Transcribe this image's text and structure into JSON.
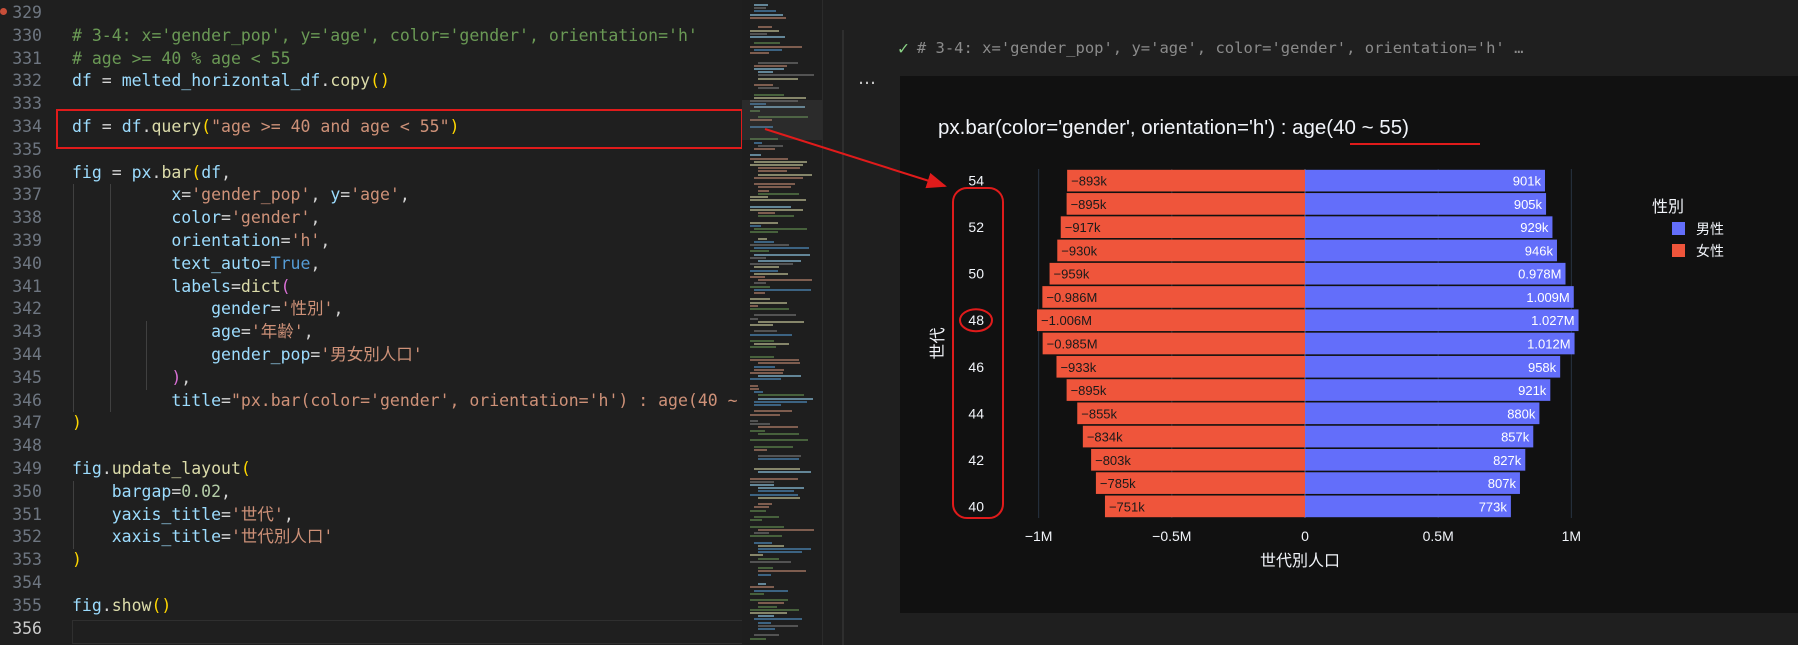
{
  "editor": {
    "lines": [
      {
        "no": "329",
        "tokens": []
      },
      {
        "no": "330",
        "tokens": [
          {
            "t": "# 3-4: x='gender_pop', y='age', color='gender', orientation='h'",
            "c": "com"
          }
        ]
      },
      {
        "no": "331",
        "tokens": [
          {
            "t": "# age >= 40 % age < 55",
            "c": "com"
          }
        ]
      },
      {
        "no": "332",
        "tokens": [
          {
            "t": "df",
            "c": "var"
          },
          {
            "t": " = ",
            "c": "op"
          },
          {
            "t": "melted_horizontal_df",
            "c": "var"
          },
          {
            "t": ".",
            "c": "op"
          },
          {
            "t": "copy",
            "c": "fn"
          },
          {
            "t": "()",
            "c": "pun"
          }
        ]
      },
      {
        "no": "333",
        "tokens": []
      },
      {
        "no": "334",
        "tokens": [
          {
            "t": "df",
            "c": "var"
          },
          {
            "t": " = ",
            "c": "op"
          },
          {
            "t": "df",
            "c": "var"
          },
          {
            "t": ".",
            "c": "op"
          },
          {
            "t": "query",
            "c": "fn"
          },
          {
            "t": "(",
            "c": "pun"
          },
          {
            "t": "\"age >= 40 and age < 55\"",
            "c": "str"
          },
          {
            "t": ")",
            "c": "pun"
          }
        ]
      },
      {
        "no": "335",
        "tokens": []
      },
      {
        "no": "336",
        "tokens": [
          {
            "t": "fig",
            "c": "var"
          },
          {
            "t": " = ",
            "c": "op"
          },
          {
            "t": "px",
            "c": "var"
          },
          {
            "t": ".",
            "c": "op"
          },
          {
            "t": "bar",
            "c": "fn"
          },
          {
            "t": "(",
            "c": "pun"
          },
          {
            "t": "df",
            "c": "var"
          },
          {
            "t": ",",
            "c": "op"
          }
        ]
      },
      {
        "no": "337",
        "tokens": [
          {
            "t": "          ",
            "c": "op"
          },
          {
            "t": "x",
            "c": "var"
          },
          {
            "t": "=",
            "c": "op"
          },
          {
            "t": "'gender_pop'",
            "c": "str"
          },
          {
            "t": ", ",
            "c": "op"
          },
          {
            "t": "y",
            "c": "var"
          },
          {
            "t": "=",
            "c": "op"
          },
          {
            "t": "'age'",
            "c": "str"
          },
          {
            "t": ",",
            "c": "op"
          }
        ]
      },
      {
        "no": "338",
        "tokens": [
          {
            "t": "          ",
            "c": "op"
          },
          {
            "t": "color",
            "c": "var"
          },
          {
            "t": "=",
            "c": "op"
          },
          {
            "t": "'gender'",
            "c": "str"
          },
          {
            "t": ",",
            "c": "op"
          }
        ]
      },
      {
        "no": "339",
        "tokens": [
          {
            "t": "          ",
            "c": "op"
          },
          {
            "t": "orientation",
            "c": "var"
          },
          {
            "t": "=",
            "c": "op"
          },
          {
            "t": "'h'",
            "c": "str"
          },
          {
            "t": ",",
            "c": "op"
          }
        ]
      },
      {
        "no": "340",
        "tokens": [
          {
            "t": "          ",
            "c": "op"
          },
          {
            "t": "text_auto",
            "c": "var"
          },
          {
            "t": "=",
            "c": "op"
          },
          {
            "t": "True",
            "c": "kw"
          },
          {
            "t": ",",
            "c": "op"
          }
        ]
      },
      {
        "no": "341",
        "tokens": [
          {
            "t": "          ",
            "c": "op"
          },
          {
            "t": "labels",
            "c": "var"
          },
          {
            "t": "=",
            "c": "op"
          },
          {
            "t": "dict",
            "c": "fn"
          },
          {
            "t": "(",
            "c": "pun2"
          }
        ]
      },
      {
        "no": "342",
        "tokens": [
          {
            "t": "              ",
            "c": "op"
          },
          {
            "t": "gender",
            "c": "var"
          },
          {
            "t": "=",
            "c": "op"
          },
          {
            "t": "'性別'",
            "c": "str"
          },
          {
            "t": ",",
            "c": "op"
          }
        ]
      },
      {
        "no": "343",
        "tokens": [
          {
            "t": "              ",
            "c": "op"
          },
          {
            "t": "age",
            "c": "var"
          },
          {
            "t": "=",
            "c": "op"
          },
          {
            "t": "'年齢'",
            "c": "str"
          },
          {
            "t": ",",
            "c": "op"
          }
        ]
      },
      {
        "no": "344",
        "tokens": [
          {
            "t": "              ",
            "c": "op"
          },
          {
            "t": "gender_pop",
            "c": "var"
          },
          {
            "t": "=",
            "c": "op"
          },
          {
            "t": "'男女別人口'",
            "c": "str"
          }
        ]
      },
      {
        "no": "345",
        "tokens": [
          {
            "t": "          ",
            "c": "op"
          },
          {
            "t": ")",
            "c": "pun2"
          },
          {
            "t": ",",
            "c": "op"
          }
        ]
      },
      {
        "no": "346",
        "tokens": [
          {
            "t": "          ",
            "c": "op"
          },
          {
            "t": "title",
            "c": "var"
          },
          {
            "t": "=",
            "c": "op"
          },
          {
            "t": "\"px.bar(color='gender', orientation='h') : age(40 ~ 55)\"",
            "c": "str"
          }
        ]
      },
      {
        "no": "347",
        "tokens": [
          {
            "t": ")",
            "c": "pun"
          }
        ]
      },
      {
        "no": "348",
        "tokens": []
      },
      {
        "no": "349",
        "tokens": [
          {
            "t": "fig",
            "c": "var"
          },
          {
            "t": ".",
            "c": "op"
          },
          {
            "t": "update_layout",
            "c": "fn"
          },
          {
            "t": "(",
            "c": "pun"
          }
        ]
      },
      {
        "no": "350",
        "tokens": [
          {
            "t": "    ",
            "c": "op"
          },
          {
            "t": "bargap",
            "c": "var"
          },
          {
            "t": "=",
            "c": "op"
          },
          {
            "t": "0.02",
            "c": "num"
          },
          {
            "t": ",",
            "c": "op"
          }
        ]
      },
      {
        "no": "351",
        "tokens": [
          {
            "t": "    ",
            "c": "op"
          },
          {
            "t": "yaxis_title",
            "c": "var"
          },
          {
            "t": "=",
            "c": "op"
          },
          {
            "t": "'世代'",
            "c": "str"
          },
          {
            "t": ",",
            "c": "op"
          }
        ]
      },
      {
        "no": "352",
        "tokens": [
          {
            "t": "    ",
            "c": "op"
          },
          {
            "t": "xaxis_title",
            "c": "var"
          },
          {
            "t": "=",
            "c": "op"
          },
          {
            "t": "'世代別人口'",
            "c": "str"
          }
        ]
      },
      {
        "no": "353",
        "tokens": [
          {
            "t": ")",
            "c": "pun"
          }
        ]
      },
      {
        "no": "354",
        "tokens": []
      },
      {
        "no": "355",
        "tokens": [
          {
            "t": "fig",
            "c": "var"
          },
          {
            "t": ".",
            "c": "op"
          },
          {
            "t": "show",
            "c": "fn"
          },
          {
            "t": "()",
            "c": "pun"
          }
        ]
      },
      {
        "no": "356",
        "tokens": []
      }
    ],
    "active_line": "356"
  },
  "output": {
    "cell_header": "# 3-4: x='gender_pop', y='age', color='gender', orientation='h' …",
    "more_label": "…"
  },
  "colors": {
    "male": "#636efa",
    "female": "#ef553b",
    "annotation": "#e01b1b",
    "plot_bg": "#111111"
  },
  "chart_data": {
    "type": "bar",
    "orientation": "h",
    "title": "px.bar(color='gender', orientation='h') : age(40 ~ 55)",
    "xlabel": "世代別人口",
    "ylabel": "世代",
    "legend_title": "性別",
    "legend_position": "top-right",
    "categories": [
      40,
      41,
      42,
      43,
      44,
      45,
      46,
      47,
      48,
      49,
      50,
      51,
      52,
      53,
      54
    ],
    "series": [
      {
        "name": "男性",
        "color": "#636efa",
        "values": [
          773000,
          807000,
          827000,
          857000,
          880000,
          921000,
          958000,
          1012000,
          1027000,
          1009000,
          978000,
          946000,
          929000,
          905000,
          901000
        ],
        "labels": [
          "773k",
          "807k",
          "827k",
          "857k",
          "880k",
          "921k",
          "958k",
          "1.012M",
          "1.027M",
          "1.009M",
          "0.978M",
          "946k",
          "929k",
          "905k",
          "901k"
        ]
      },
      {
        "name": "女性",
        "color": "#ef553b",
        "values": [
          -751000,
          -785000,
          -803000,
          -834000,
          -855000,
          -895000,
          -933000,
          -985000,
          -1006000,
          -986000,
          -959000,
          -930000,
          -917000,
          -895000,
          -893000
        ],
        "labels": [
          "−751k",
          "−785k",
          "−803k",
          "−834k",
          "−855k",
          "−895k",
          "−933k",
          "−0.985M",
          "−1.006M",
          "−0.986M",
          "−959k",
          "−930k",
          "−917k",
          "−895k",
          "−893k"
        ]
      }
    ],
    "xlim": [
      -1100000,
      1100000
    ],
    "ylim": [
      39.5,
      54.5
    ],
    "xticks": [
      -1000000,
      -500000,
      0,
      500000,
      1000000
    ],
    "xtick_labels": [
      "−1M",
      "−0.5M",
      "0",
      "0.5M",
      "1M"
    ],
    "yticks": [
      40,
      42,
      44,
      46,
      48,
      50,
      52,
      54
    ],
    "ytick_labels": [
      "40",
      "42",
      "44",
      "46",
      "48",
      "50",
      "52",
      "54"
    ],
    "grid": true
  }
}
